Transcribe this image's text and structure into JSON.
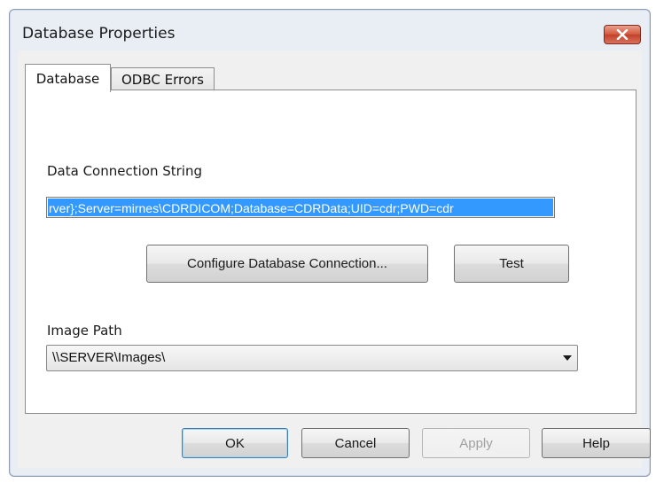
{
  "window": {
    "title": "Database Properties"
  },
  "tabs": [
    {
      "label": "Database",
      "selected": true
    },
    {
      "label": "ODBC Errors",
      "selected": false
    }
  ],
  "connection": {
    "label": "Data Connection String",
    "value": "rver};Server=mirnes\\CDRDICOM;Database=CDRData;UID=cdr;PWD=cdr",
    "selected_color": "#3399ff"
  },
  "buttons": {
    "configure": "Configure Database Connection...",
    "test": "Test",
    "ok": "OK",
    "cancel": "Cancel",
    "apply": "Apply",
    "help": "Help"
  },
  "image_path": {
    "label": "Image Path",
    "value": "\\\\SERVER\\Images\\"
  },
  "icons": {
    "close": "close-icon",
    "dropdown": "chevron-down-icon"
  }
}
